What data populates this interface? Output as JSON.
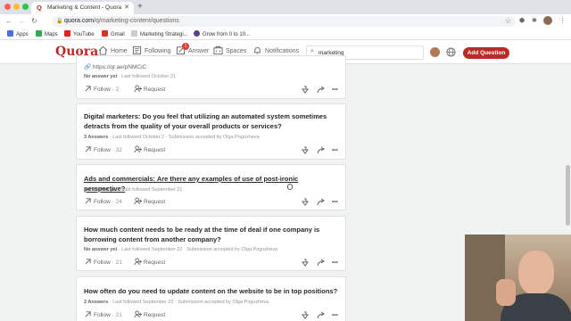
{
  "browser": {
    "tab_title": "Marketing & Content - Quora",
    "tab_favicon": "Q",
    "url_host": "quora.com",
    "url_path": "/q/marketing-content/questions",
    "bookmarks": [
      "Apps",
      "Maps",
      "YouTube",
      "Gmail",
      "Marketing Strategi...",
      "Grow from 0 to 10..."
    ]
  },
  "quora": {
    "logo": "Quora",
    "nav": {
      "home": "Home",
      "following": "Following",
      "answer": "Answer",
      "answer_badge": "1",
      "spaces": "Spaces",
      "notifications": "Notifications"
    },
    "search_value": "marketing",
    "add_question": "Add Question"
  },
  "questions": [
    {
      "url": "https://qr.ae/pNMCiC",
      "meta_answers": "No answer yet",
      "meta_rest": " · Last followed October 21",
      "follow_label": "Follow",
      "follow_count": "2",
      "request_label": "Request"
    },
    {
      "title": "Digital marketers: Do you feel that utilizing an automated system sometimes detracts from the quality of your overall products or services?",
      "meta_answers": "3 Answers",
      "meta_rest": " · Last followed October 2 · Submission accepted by Olga Pogozheva",
      "follow_label": "Follow",
      "follow_count": "32",
      "request_label": "Request"
    },
    {
      "title": "Ads and commercials: Are there any examples of use of post-ironic perspective?",
      "meta_answers": "No answer yet",
      "meta_rest": " · Last followed September 21",
      "follow_label": "Follow",
      "follow_count": "24",
      "request_label": "Request"
    },
    {
      "title": "How much content needs to be ready at the time of deal if one company is borrowing content from another company?",
      "meta_answers": "No answer yet",
      "meta_rest": " · Last followed September 22 · Submission accepted by Olga Pogozheva",
      "follow_label": "Follow",
      "follow_count": "21",
      "request_label": "Request"
    },
    {
      "title": "How often do you need to update content on the website to be in top positions?",
      "meta_answers": "2 Answers",
      "meta_rest": " · Last followed September 22 · Submission accepted by Olga Pogozheva",
      "follow_label": "Follow",
      "follow_count": "21",
      "request_label": "Request"
    }
  ],
  "colors": {
    "quora_red": "#b92b27",
    "page_bg": "#f1f2f2",
    "text": "#282829",
    "muted": "#939598"
  },
  "icons": [
    "lock-icon",
    "home-icon",
    "following-icon",
    "answer-icon",
    "spaces-icon",
    "bell-icon",
    "search-icon",
    "globe-icon",
    "follow-icon",
    "request-icon",
    "downvote-icon",
    "share-icon",
    "more-icon"
  ]
}
